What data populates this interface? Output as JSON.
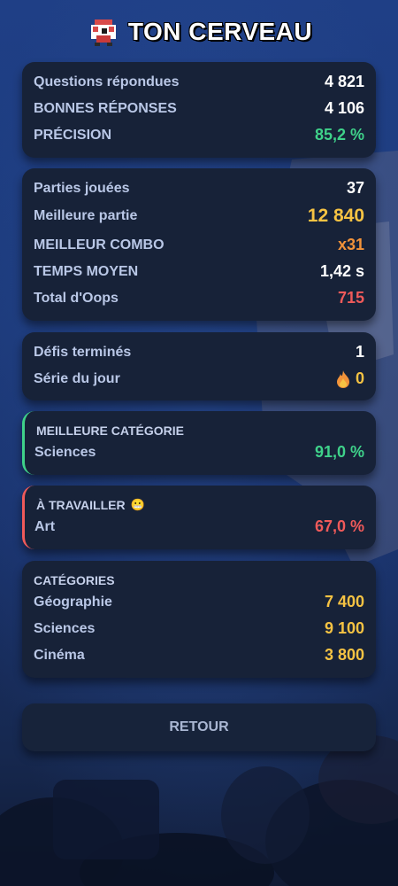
{
  "header": {
    "title": "TON CERVEAU",
    "logo_icon": "pixel-brain-icon"
  },
  "card1": [
    {
      "label": "Questions répondues",
      "value": "4 821"
    },
    {
      "label": "BONNES RÉPONSES",
      "value": "4 106"
    },
    {
      "label": "PRÉCISION",
      "value": "85,2 %"
    }
  ],
  "card2": [
    {
      "label": "Parties jouées",
      "value": "37"
    },
    {
      "label": "Meilleure partie",
      "value": "12 840"
    },
    {
      "label": "MEILLEUR COMBO",
      "value": "x31"
    },
    {
      "label": "TEMPS MOYEN",
      "value": "1,42 s"
    },
    {
      "label": "Total d'Oops",
      "value": "715"
    }
  ],
  "card3": [
    {
      "label": "Défis terminés",
      "value": "1"
    },
    {
      "label": "Série du jour",
      "value": "0",
      "icon": "flame-icon"
    }
  ],
  "best_category": {
    "heading": "MEILLEURE CATÉGORIE",
    "label": "Sciences",
    "value": "91,0 %"
  },
  "to_work": {
    "heading": "À TRAVAILLER",
    "emoji": "😬",
    "label": "Art",
    "value": "67,0 %"
  },
  "categories": {
    "heading": "CATÉGORIES",
    "items": [
      {
        "label": "Géographie",
        "value": "7 400"
      },
      {
        "label": "Sciences",
        "value": "9 100"
      },
      {
        "label": "Cinéma",
        "value": "3 800"
      }
    ]
  },
  "back_button": {
    "label": "RETOUR"
  },
  "colors": {
    "green": "#3fd28a",
    "gold": "#f6c343",
    "orange": "#f2933a",
    "red": "#ef5a5a",
    "card": "#172238"
  }
}
